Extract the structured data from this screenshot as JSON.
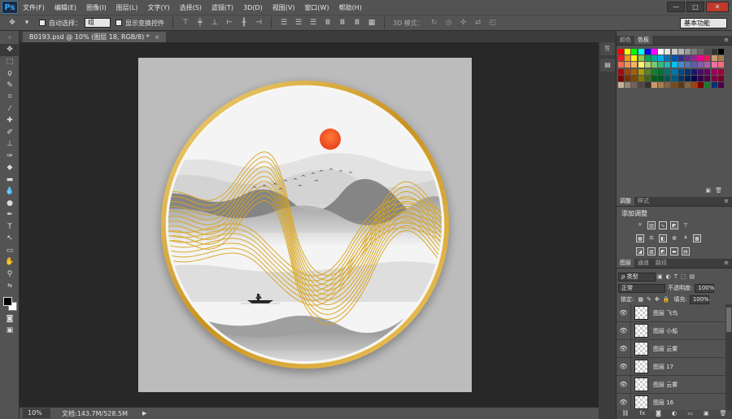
{
  "app": {
    "logo": "Ps"
  },
  "menu": [
    "文件(F)",
    "编辑(E)",
    "图像(I)",
    "图层(L)",
    "文字(Y)",
    "选择(S)",
    "滤镜(T)",
    "3D(D)",
    "视图(V)",
    "窗口(W)",
    "帮助(H)"
  ],
  "window_controls": {
    "minimize": "—",
    "maximize": "□",
    "close": "✕"
  },
  "options": {
    "auto_select_label": "自动选择：",
    "auto_select_value": "组",
    "transform_label": "显示变换控件",
    "mode3d_label": "3D 模式：",
    "workspace": "基本功能"
  },
  "document": {
    "tab_title": "B0193.psd @ 10% (图层 18, RGB/8) *",
    "close": "×"
  },
  "status": {
    "zoom": "10%",
    "doc_info": "文档:143.7M/528.5M",
    "arrow": "▶"
  },
  "panels": {
    "color_tabs": [
      "颜色",
      "色板"
    ],
    "adjust_tabs": [
      "调整",
      "样式"
    ],
    "adjust_title": "添加调整",
    "layer_tabs": [
      "图层",
      "通道",
      "路径"
    ],
    "filter_kind": "ρ 类型",
    "blend_mode": "正常",
    "opacity_label": "不透明度:",
    "opacity_value": "100%",
    "lock_label": "锁定:",
    "fill_label": "填充:",
    "fill_value": "100%",
    "layers": [
      "图层 飞鸟",
      "图层 小船",
      "图层 云雾",
      "图层 17",
      "图层 云雾",
      "图层 16"
    ]
  },
  "swatch_colors": [
    "#ff0000",
    "#ffff00",
    "#00ff00",
    "#00ffff",
    "#0000ff",
    "#ff00ff",
    "#ffffff",
    "#e6e6e6",
    "#cccccc",
    "#b3b3b3",
    "#999999",
    "#808080",
    "#666666",
    "#4d4d4d",
    "#333333",
    "#000000",
    "#ed1c24",
    "#f7941d",
    "#fff200",
    "#8dc63f",
    "#00a651",
    "#00a99d",
    "#00aeef",
    "#0072bc",
    "#0054a6",
    "#2e3192",
    "#662d91",
    "#92278f",
    "#ec008c",
    "#ed145b",
    "#c69c6d",
    "#a67c52",
    "#f26c4f",
    "#f68e55",
    "#fbaf5c",
    "#fff467",
    "#acd372",
    "#7cc576",
    "#3bb878",
    "#1abbb4",
    "#00bff3",
    "#438cca",
    "#5574b9",
    "#605ca8",
    "#855fa8",
    "#a763a8",
    "#f06ea9",
    "#f26d7d",
    "#9e0b0f",
    "#a0410d",
    "#a36209",
    "#aba000",
    "#598527",
    "#1a7b30",
    "#007236",
    "#00746b",
    "#0076a3",
    "#004b80",
    "#003471",
    "#1b1464",
    "#440e62",
    "#630460",
    "#9e005d",
    "#9e0039",
    "#790000",
    "#7b2e00",
    "#7d4900",
    "#827b00",
    "#406618",
    "#005e20",
    "#005826",
    "#005952",
    "#005b7f",
    "#003663",
    "#002157",
    "#0d004c",
    "#32004b",
    "#4b0049",
    "#7b0046",
    "#7a0026",
    "#c7b299",
    "#998675",
    "#736357",
    "#534741",
    "#37302d",
    "#c69c6d",
    "#a67c52",
    "#8c6239",
    "#754c24",
    "#603913",
    "#8c6239",
    "#a0410d",
    "#790000",
    "#1a7b30",
    "#003471",
    "#4b0049"
  ]
}
